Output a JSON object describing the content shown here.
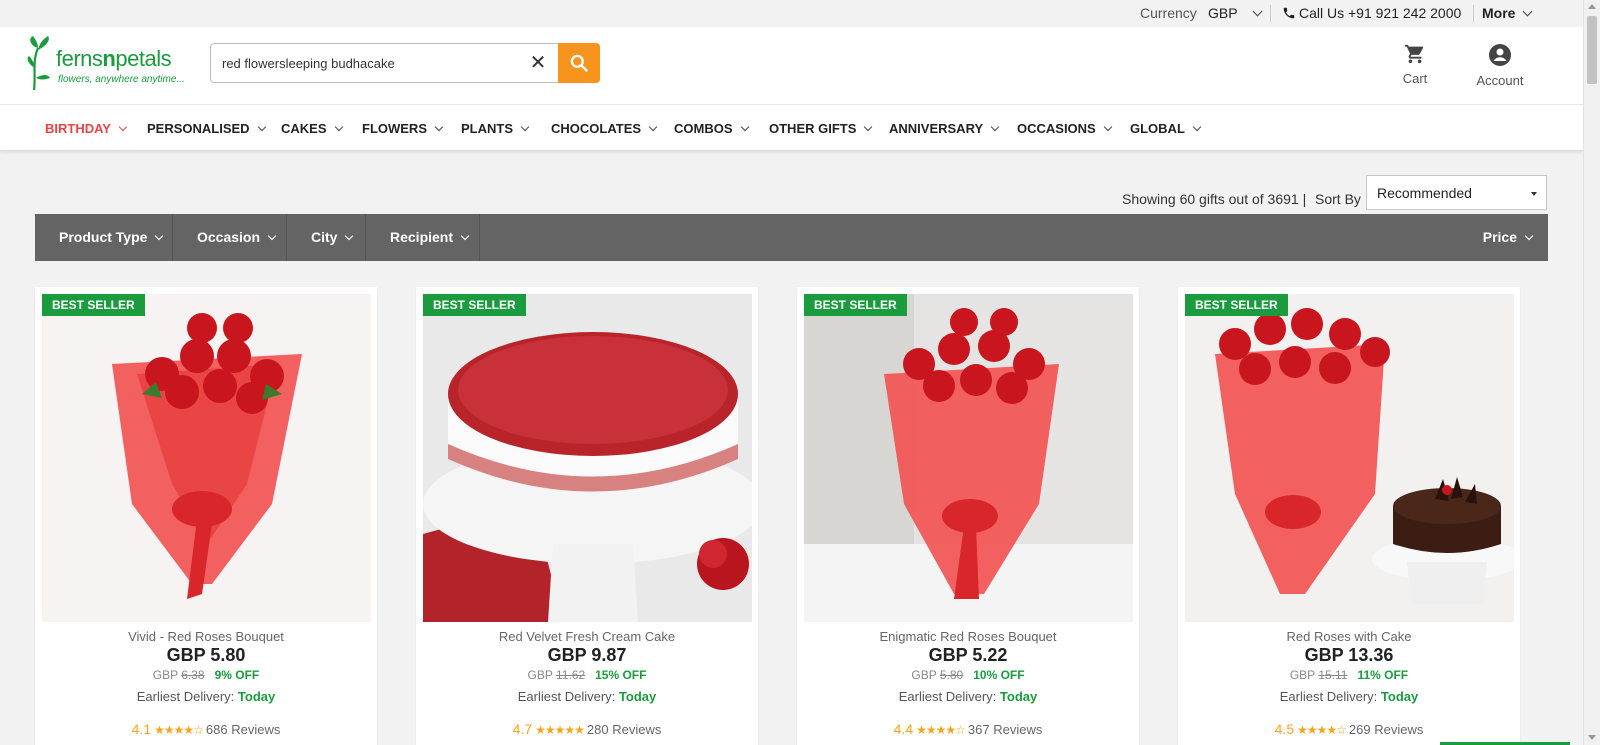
{
  "topbar": {
    "currency_label": "Currency",
    "currency_value": "GBP",
    "call_label": "Call Us +91 921 242 2000",
    "more_label": "More"
  },
  "header": {
    "logo_brand_1": "ferns",
    "logo_brand_2": "n",
    "logo_brand_3": "petals",
    "logo_tagline": "flowers, anywhere anytime...",
    "search_query": "red flowersleeping budhacake",
    "cart_label": "Cart",
    "account_label": "Account"
  },
  "nav": {
    "items": [
      "BIRTHDAY",
      "PERSONALISED",
      "CAKES",
      "FLOWERS",
      "PLANTS",
      "CHOCOLATES",
      "COMBOS",
      "OTHER GIFTS",
      "ANNIVERSARY",
      "OCCASIONS",
      "GLOBAL"
    ],
    "active": "BIRTHDAY"
  },
  "results": {
    "showing": "Showing 60 gifts out of 3691 |",
    "sort_by_label": "Sort By",
    "sort_value": "Recommended"
  },
  "filters": {
    "items": [
      "Product Type",
      "Occasion",
      "City",
      "Recipient"
    ],
    "price_label": "Price"
  },
  "products": [
    {
      "badge": "BEST SELLER",
      "title": "Vivid - Red Roses Bouquet",
      "price": "GBP  5.80",
      "currency": "GBP",
      "old_price": "6.38",
      "discount": "9% OFF",
      "delivery_label": "Earliest Delivery:",
      "delivery_value": "Today",
      "rating": "4.1",
      "stars": "★★★★☆",
      "reviews": "686 Reviews"
    },
    {
      "badge": "BEST SELLER",
      "title": "Red Velvet Fresh Cream Cake",
      "price": "GBP  9.87",
      "currency": "GBP",
      "old_price": "11.62",
      "discount": "15% OFF",
      "delivery_label": "Earliest Delivery:",
      "delivery_value": "Today",
      "rating": "4.7",
      "stars": "★★★★★",
      "reviews": "280 Reviews"
    },
    {
      "badge": "BEST SELLER",
      "title": "Enigmatic Red Roses Bouquet",
      "price": "GBP  5.22",
      "currency": "GBP",
      "old_price": "5.80",
      "discount": "10% OFF",
      "delivery_label": "Earliest Delivery:",
      "delivery_value": "Today",
      "rating": "4.4",
      "stars": "★★★★☆",
      "reviews": "367 Reviews"
    },
    {
      "badge": "BEST SELLER",
      "title": "Red Roses with Cake",
      "price": "GBP  13.36",
      "currency": "GBP",
      "old_price": "15.11",
      "discount": "11% OFF",
      "delivery_label": "Earliest Delivery:",
      "delivery_value": "Today",
      "rating": "4.5",
      "stars": "★★★★☆",
      "reviews": "269 Reviews"
    }
  ],
  "colors": {
    "brand_green": "#1a9c3e",
    "accent_orange": "#f7941d",
    "active_red": "#e94343",
    "filter_bar": "#646464",
    "rating_gold": "#f7a51c"
  },
  "icons": {
    "phone": "phone-icon",
    "search": "search-icon",
    "clear": "close-icon",
    "cart": "cart-icon",
    "account": "account-icon",
    "chevron": "chevron-down-icon"
  }
}
